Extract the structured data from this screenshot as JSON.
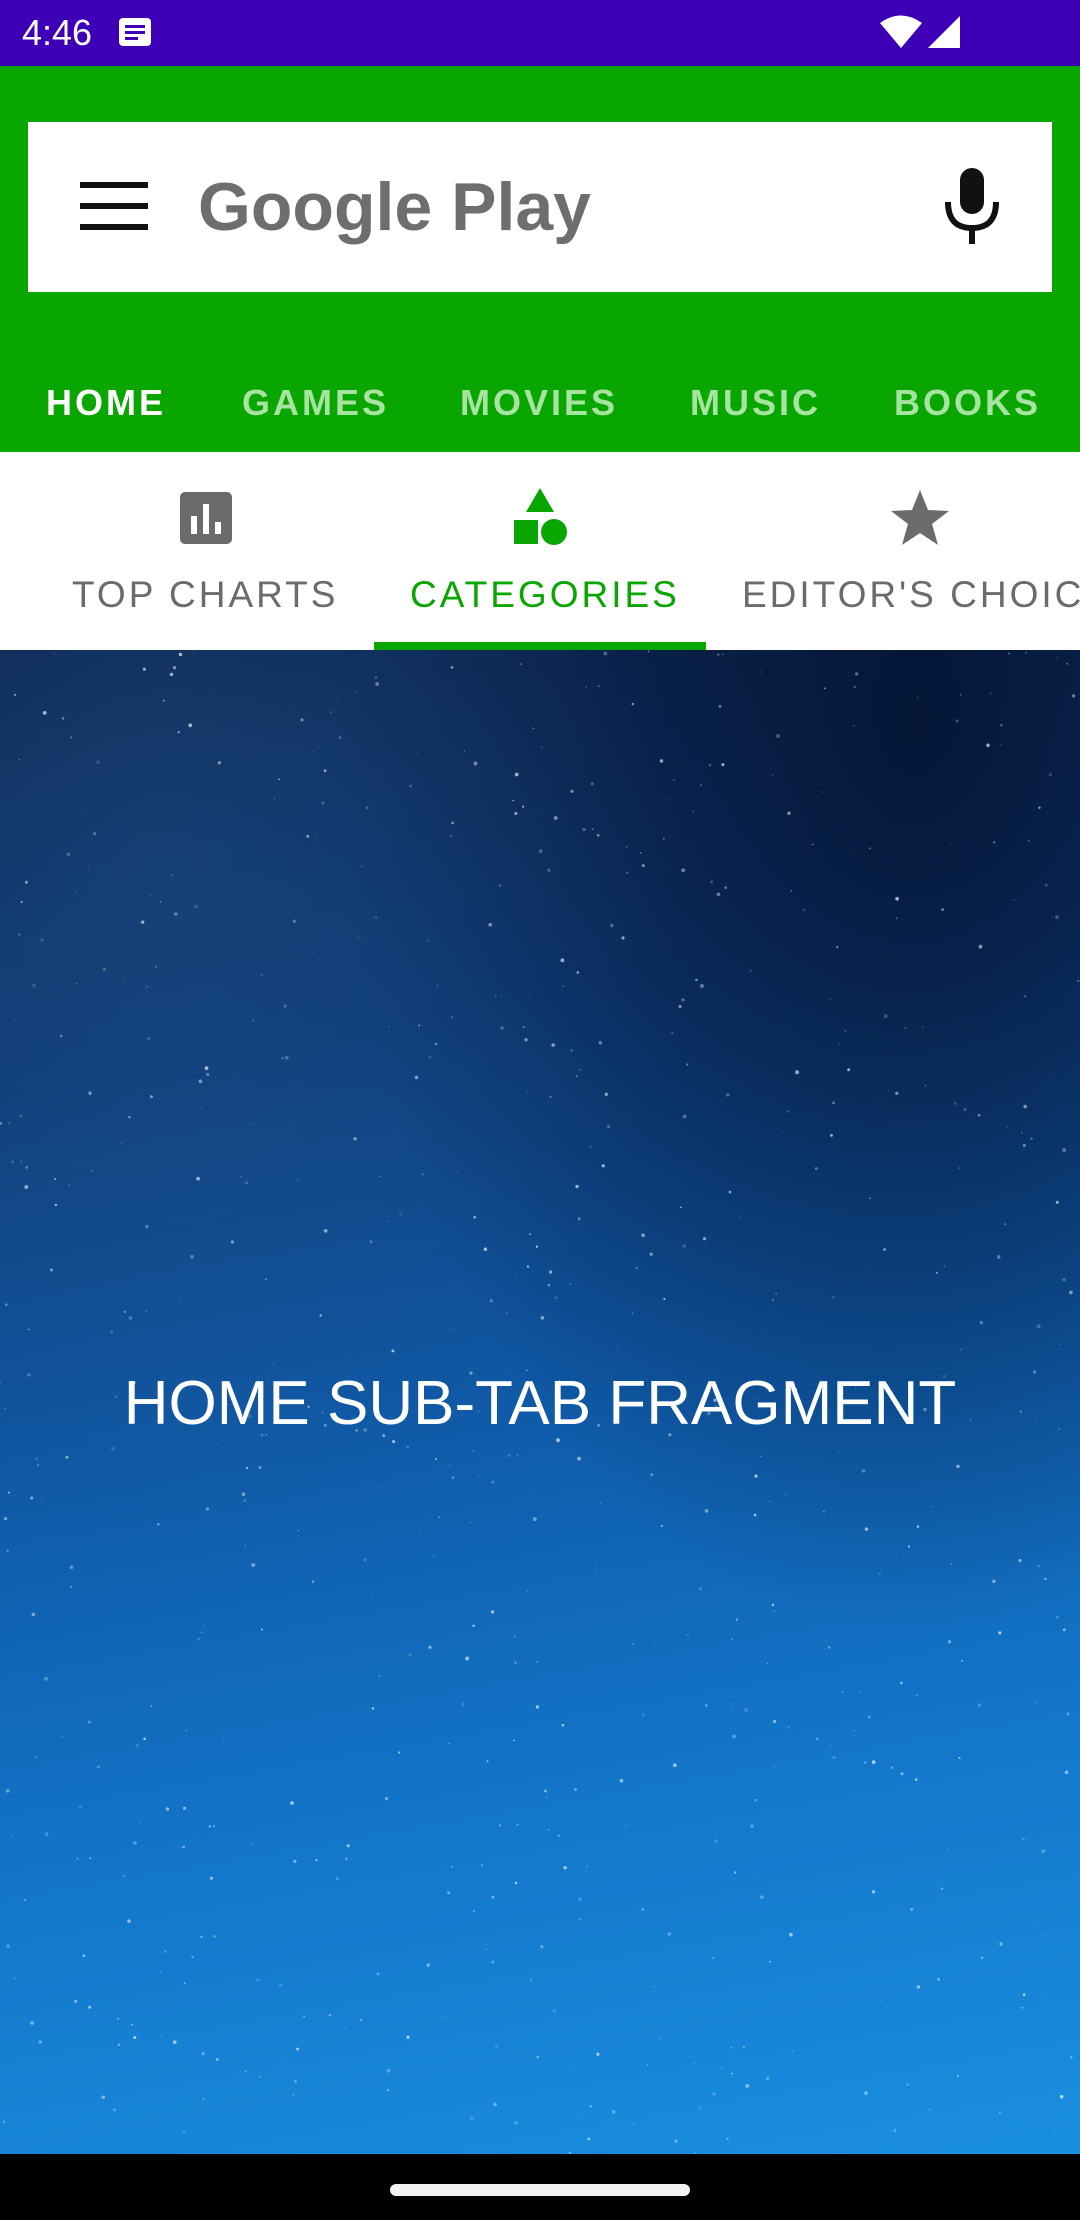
{
  "status_bar": {
    "time": "4:46",
    "background": "#3d00b6",
    "icons": [
      "notification-icon",
      "wifi-icon",
      "signal-icon"
    ]
  },
  "toolbar": {
    "background": "#0aa600",
    "search": {
      "title": "Google Play",
      "menu_icon": "menu-icon",
      "mic_icon": "mic-icon"
    },
    "tabs": [
      {
        "label": "HOME",
        "active": true
      },
      {
        "label": "GAMES",
        "active": false
      },
      {
        "label": "MOVIES",
        "active": false
      },
      {
        "label": "MUSIC",
        "active": false
      },
      {
        "label": "BOOKS",
        "active": false
      }
    ]
  },
  "sub_tabs": [
    {
      "label": "TOP CHARTS",
      "icon": "bar-chart-icon",
      "active": false
    },
    {
      "label": "CATEGORIES",
      "icon": "shapes-icon",
      "active": true
    },
    {
      "label": "EDITOR'S CHOIC",
      "icon": "star-icon",
      "active": false
    }
  ],
  "content": {
    "text": "HOME SUB-TAB FRAGMENT"
  },
  "colors": {
    "accent": "#0aa600",
    "inactive_tab": "#a7e3a1",
    "sub_tab_inactive": "#6b6b6b"
  }
}
